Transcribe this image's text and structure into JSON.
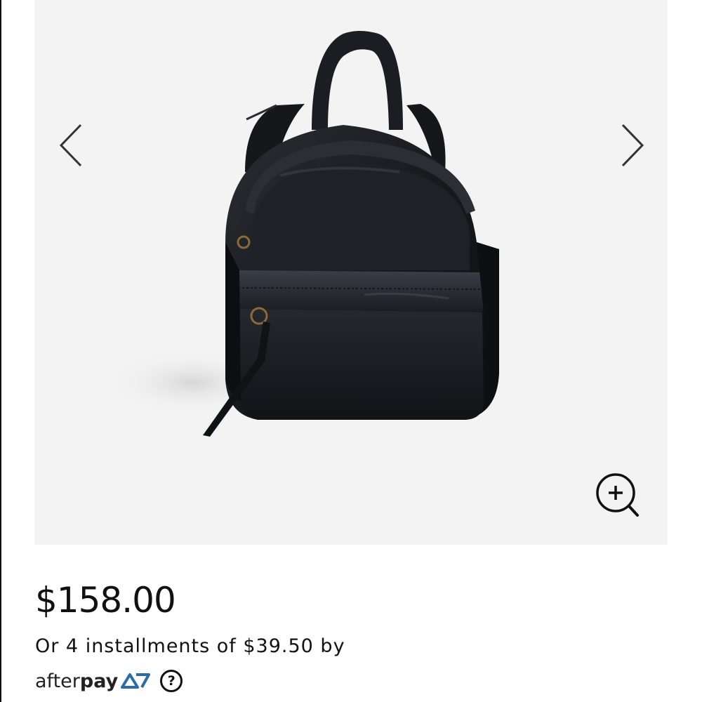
{
  "product": {
    "image_subject": "black leather mini backpack",
    "price": "$158.00",
    "installments_text": "Or 4 installments of $39.50 by"
  },
  "gallery": {
    "prev_icon": "chevron-left-icon",
    "next_icon": "chevron-right-icon",
    "zoom_icon": "zoom-in-icon"
  },
  "afterpay": {
    "logo_after": "after",
    "logo_pay": "pay",
    "help_label": "?",
    "brand_color": "#2c6aa8"
  },
  "colors": {
    "gallery_background": "#f3f3f3",
    "text": "#111111"
  }
}
